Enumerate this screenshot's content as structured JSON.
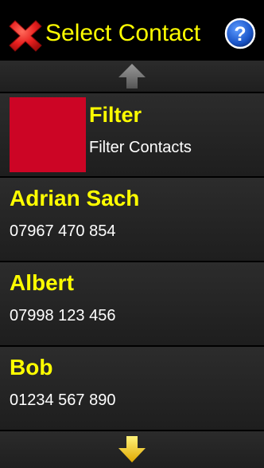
{
  "header": {
    "title": "Select Contact",
    "close_icon": "close-x-icon",
    "help_icon": "help-question-icon",
    "help_symbol": "?"
  },
  "scroll": {
    "up_icon": "arrow-up-icon",
    "down_icon": "arrow-down-icon"
  },
  "filter": {
    "title": "Filter",
    "subtitle": "Filter Contacts",
    "swatch_color": "#cc0525"
  },
  "contacts": [
    {
      "name": "Adrian Sach",
      "phone": "07967 470 854"
    },
    {
      "name": "Albert",
      "phone": "07998 123 456"
    },
    {
      "name": "Bob",
      "phone": "01234 567 890"
    }
  ],
  "colors": {
    "accent": "#ffff00",
    "background": "#000000",
    "row": "#262626",
    "close": "#e8201f",
    "help": "#1a55c8"
  }
}
